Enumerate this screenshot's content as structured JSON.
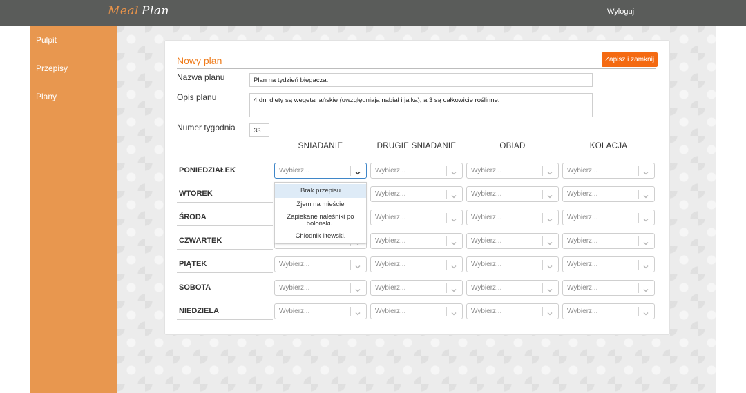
{
  "app": {
    "logo_part1": "Meal",
    "logo_part2": "Plan",
    "logout": "Wyloguj"
  },
  "sidebar": {
    "items": [
      {
        "label": "Pulpit"
      },
      {
        "label": "Przepisy"
      },
      {
        "label": "Plany"
      }
    ]
  },
  "form": {
    "title": "Nowy plan",
    "save_label": "Zapisz i zamknij",
    "name_label": "Nazwa planu",
    "name_value": "Plan na tydzień biegacza.",
    "desc_label": "Opis planu",
    "desc_value": "4 dni diety są wegetariańskie (uwzględniają nabiał i jajka), a 3 są całkowicie roślinne.",
    "week_label": "Numer tygodnia",
    "week_value": "33"
  },
  "meals": [
    "SNIADANIE",
    "DRUGIE SNIADANIE",
    "OBIAD",
    "KOLACJA"
  ],
  "days": [
    "PONIEDZIAŁEK",
    "WTOREK",
    "ŚRODA",
    "CZWARTEK",
    "PIĄTEK",
    "SOBOTA",
    "NIEDZIELA"
  ],
  "select_placeholder": "Wybierz...",
  "dropdown_options": [
    "Brak przepisu",
    "Zjem na mieście",
    "Zapiekane naleśniki po bolońsku.",
    "Chłodnik litewski."
  ]
}
